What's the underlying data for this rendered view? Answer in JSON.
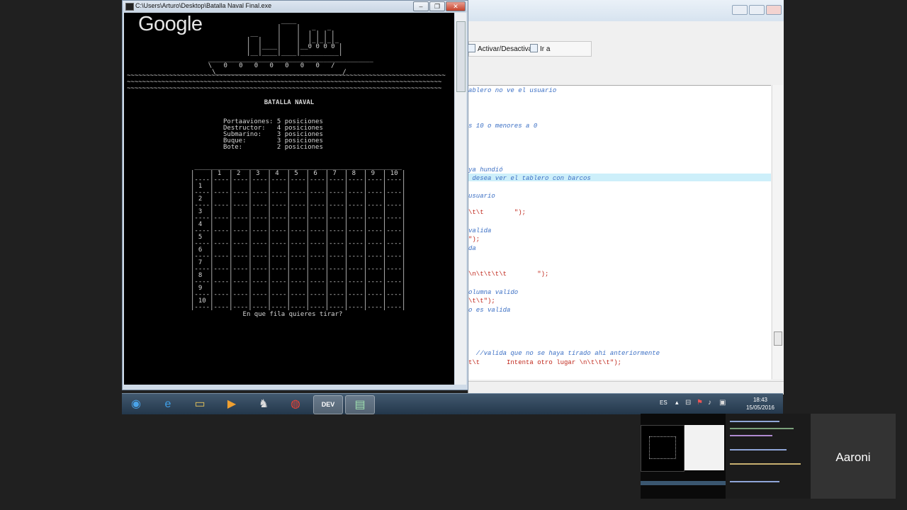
{
  "console": {
    "title": "C:\\Users\\Arturo\\Desktop\\Batalla Naval Final.exe",
    "watermark": "Google",
    "ship_art": [
      "                            ____",
      "                           |    |   _   _",
      "                    __     |    |  | | | |",
      "                   |  |    |    |  |_|_|_|_",
      "                   |  |____|    |__0 0 0 0 |",
      "                   |__|____|____|__________|",
      "         ___________________________________________",
      "         \\   0   0   0   0   0   0   0   /",
      "          \\_________________________________/"
    ],
    "waves": [
      "~~~~~~~~~~~~~~~~~~~~~~~~~~~~~~~~~~~~~~~~~~~~~~~~~~~~~~~~~~~~~~~~~~~~~~~~~~~~~~~~~~~",
      "~~~~~~~~~~~~~~~~~~~~~~~~~~~~~~~~~~~~~~~~~~~~~~~~~~~~~~~~~~~~~~~~~~~~~~~~~~~~~~~~~~",
      "~~~~~~~~~~~~~~~~~~~~~~~~~~~~~~~~~~~~~~~~~~~~~~~~~~~~~~~~~~~~~~~~~~~~~~~~~~~~~~~~~~"
    ],
    "heading": "BATALLA NAVAL",
    "ships": [
      "Portaaviones: 5 posiciones",
      "Destructor:   4 posiciones",
      "Submarino:    3 posiciones",
      "Buque:        3 posiciones",
      "Bote:         2 posiciones"
    ],
    "board_columns": [
      "1",
      "2",
      "3",
      "4",
      "5",
      "6",
      "7",
      "8",
      "9",
      "10"
    ],
    "board_rows": [
      "1",
      "2",
      "3",
      "4",
      "5",
      "6",
      "7",
      "8",
      "9",
      "10"
    ],
    "prompt": "En que fila quieres tirar?"
  },
  "editor": {
    "toolbar": {
      "toggle_label": "Activar/Desactivar",
      "goto_label": "Ir a"
    },
    "code_lines": [
      {
        "text": "ablero no ve el usuario",
        "kind": "comment"
      },
      {
        "text": "s 10 o menores a 0",
        "kind": "comment"
      },
      {
        "text": "ya hundió",
        "kind": "comment"
      },
      {
        "text": " desea ver el tablero con barcos",
        "kind": "comment"
      },
      {
        "text": "usuario",
        "kind": "comment"
      },
      {
        "text": "\\t\\t        \");",
        "kind": "str"
      },
      {
        "text": "valida",
        "kind": "comment"
      },
      {
        "text": "\");",
        "kind": "str"
      },
      {
        "text": "da",
        "kind": "comment"
      },
      {
        "text": "\\n\\t\\t\\t\\t        \");",
        "kind": "str"
      },
      {
        "text": "olumna valido",
        "kind": "comment"
      },
      {
        "text": "\\t\\t\");",
        "kind": "str"
      },
      {
        "text": "o es valida",
        "kind": "comment"
      },
      {
        "text": "  //valida que no se haya tirado ahi anteriormente",
        "kind": "comment"
      },
      {
        "text": "t\\t       Intenta otro lugar \\n\\t\\t\\t\");",
        "kind": "str"
      }
    ]
  },
  "taskbar": {
    "apps": [
      {
        "name": "start-orb",
        "glyph": "◉",
        "color": "#4aa3e8"
      },
      {
        "name": "internet-explorer-icon",
        "glyph": "e",
        "color": "#3fa0e8"
      },
      {
        "name": "file-explorer-icon",
        "glyph": "▭",
        "color": "#e6c35a"
      },
      {
        "name": "media-player-icon",
        "glyph": "▶",
        "color": "#f0a030"
      },
      {
        "name": "inkscape-icon",
        "glyph": "♞",
        "color": "#ddd"
      },
      {
        "name": "chrome-icon",
        "glyph": "◍",
        "color": "#e94235"
      },
      {
        "name": "devcpp-icon",
        "glyph": "DEV",
        "color": "#ffffff"
      },
      {
        "name": "console-app-icon",
        "glyph": "▤",
        "color": "#9fe0b0"
      }
    ],
    "language": "ES",
    "time": "18:43",
    "date": "15/05/2016"
  },
  "participant": {
    "name": "Aaroni"
  }
}
